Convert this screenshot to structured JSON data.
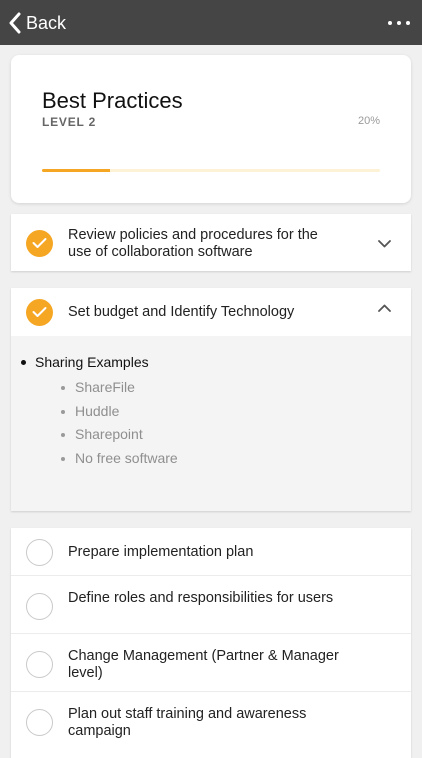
{
  "nav": {
    "back_label": "Back"
  },
  "header": {
    "title": "Best Practices",
    "level": "LEVEL 2",
    "progress_label": "20%",
    "progress_value": 0.2,
    "accent_color": "#f5a623"
  },
  "tasks": [
    {
      "label": "Review policies and procedures for the use of collaboration software",
      "done": true
    },
    {
      "label": "Set budget and Identify Technology",
      "done": true,
      "expanded": true
    }
  ],
  "expanded": {
    "heading": "Sharing Examples",
    "items": [
      "ShareFile",
      "Huddle",
      "Sharepoint",
      "No free software"
    ]
  },
  "todo": [
    {
      "label": "Prepare implementation plan"
    },
    {
      "label": "Define roles and responsibilities for users"
    },
    {
      "label": "Change Management (Partner & Manager level)"
    },
    {
      "label": "Plan out staff training and awareness campaign"
    }
  ]
}
